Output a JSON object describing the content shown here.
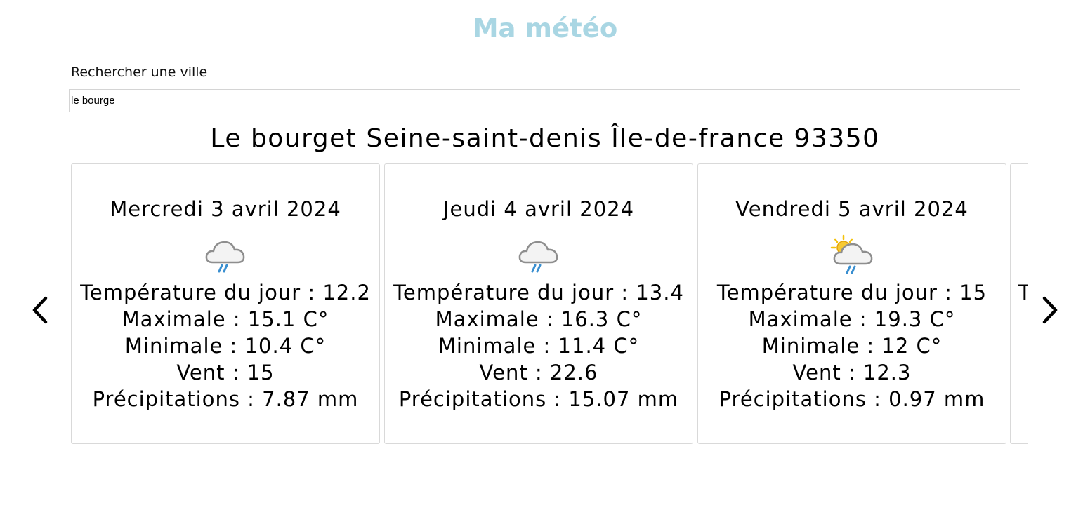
{
  "header": {
    "title": "Ma météo"
  },
  "search": {
    "label": "Rechercher une ville",
    "value": "le bourge"
  },
  "location": {
    "title": "Le bourget Seine-saint-denis Île-de-france 93350"
  },
  "colors": {
    "title": "#a9d6e3",
    "card_border": "#d9d9d9",
    "rain": "#3a8fd0",
    "sun": "#f4c20d"
  },
  "forecast": [
    {
      "date": "Mercredi 3 avril 2024",
      "icon": "rain-cloud-icon",
      "temp": "Température du jour : 12.2",
      "max": "Maximale : 15.1 C°",
      "min": "Minimale : 10.4 C°",
      "wind": "Vent : 15",
      "precip": "Précipitations : 7.87 mm"
    },
    {
      "date": "Jeudi 4 avril 2024",
      "icon": "rain-cloud-icon",
      "temp": "Température du jour : 13.4",
      "max": "Maximale : 16.3 C°",
      "min": "Minimale : 11.4 C°",
      "wind": "Vent : 22.6",
      "precip": "Précipitations : 15.07 mm"
    },
    {
      "date": "Vendredi 5 avril 2024",
      "icon": "sun-rain-cloud-icon",
      "temp": "Température du jour : 15",
      "max": "Maximale : 19.3 C°",
      "min": "Minimale : 12 C°",
      "wind": "Vent : 12.3",
      "precip": "Précipitations : 0.97 mm"
    },
    {
      "date": "",
      "icon": "",
      "temp": "T",
      "max": "",
      "min": "",
      "wind": "",
      "precip": ""
    }
  ],
  "nav": {
    "prev_icon": "chevron-left-icon",
    "next_icon": "chevron-right-icon"
  }
}
